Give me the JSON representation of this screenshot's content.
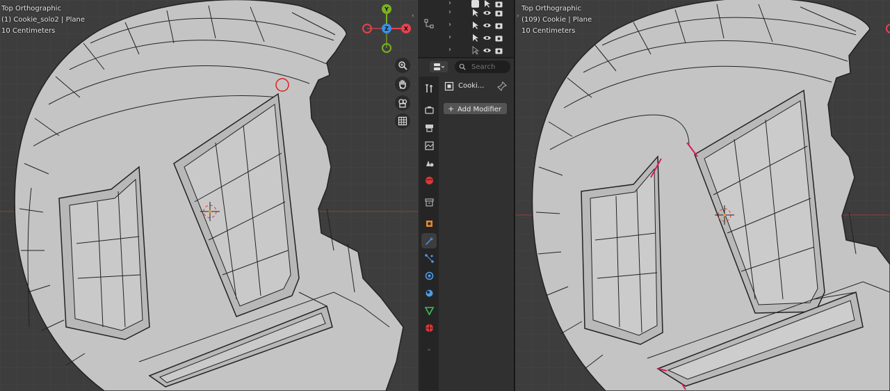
{
  "left_viewport": {
    "view_name": "Top Orthographic",
    "object_info": "(1) Cookie_solo2 | Plane",
    "scale": "10 Centimeters",
    "gizmo": {
      "x": "X",
      "y": "Y",
      "z": "Z"
    }
  },
  "right_viewport": {
    "view_name": "Top Orthographic",
    "object_info": "(109) Cookie | Plane",
    "scale": "10 Centimeters"
  },
  "nav_tools": [
    "zoom-icon",
    "hand-pan-icon",
    "camera-view-icon",
    "ortho-grid-icon"
  ],
  "outliner": {
    "rows": [
      {
        "icons": [
          "select-arrow-icon",
          "eye-icon",
          "camera-icon"
        ]
      },
      {
        "icons": [
          "select-arrow-icon",
          "eye-icon",
          "camera-icon"
        ]
      },
      {
        "icons": [
          "select-arrow-icon",
          "eye-icon",
          "camera-icon"
        ]
      },
      {
        "icons": [
          "select-arrow-icon",
          "eye-icon",
          "camera-icon"
        ]
      }
    ]
  },
  "properties": {
    "search_placeholder": "Search",
    "object_name": "Cooki...",
    "add_modifier_label": "Add Modifier",
    "tabs": [
      "tool-icon",
      "render-icon",
      "output-icon",
      "view-layer-icon",
      "scene-icon",
      "world-icon",
      "collection-icon",
      "object-icon",
      "modifier-wrench-icon",
      "particles-icon",
      "physics-icon",
      "constraints-icon",
      "data-icon",
      "material-icon"
    ],
    "active_tab": "modifier-wrench-icon"
  },
  "colors": {
    "viewport_bg": "#3d3d3d",
    "grid_line": "#474747",
    "x_axis": "#9a3b3b",
    "gizmo_x": "#e6434f",
    "gizmo_y": "#7bb120",
    "gizmo_z": "#3a8fe6",
    "mesh_face": "#c4c4c4",
    "mesh_edge": "#222222",
    "highlight": "#d81b60"
  }
}
